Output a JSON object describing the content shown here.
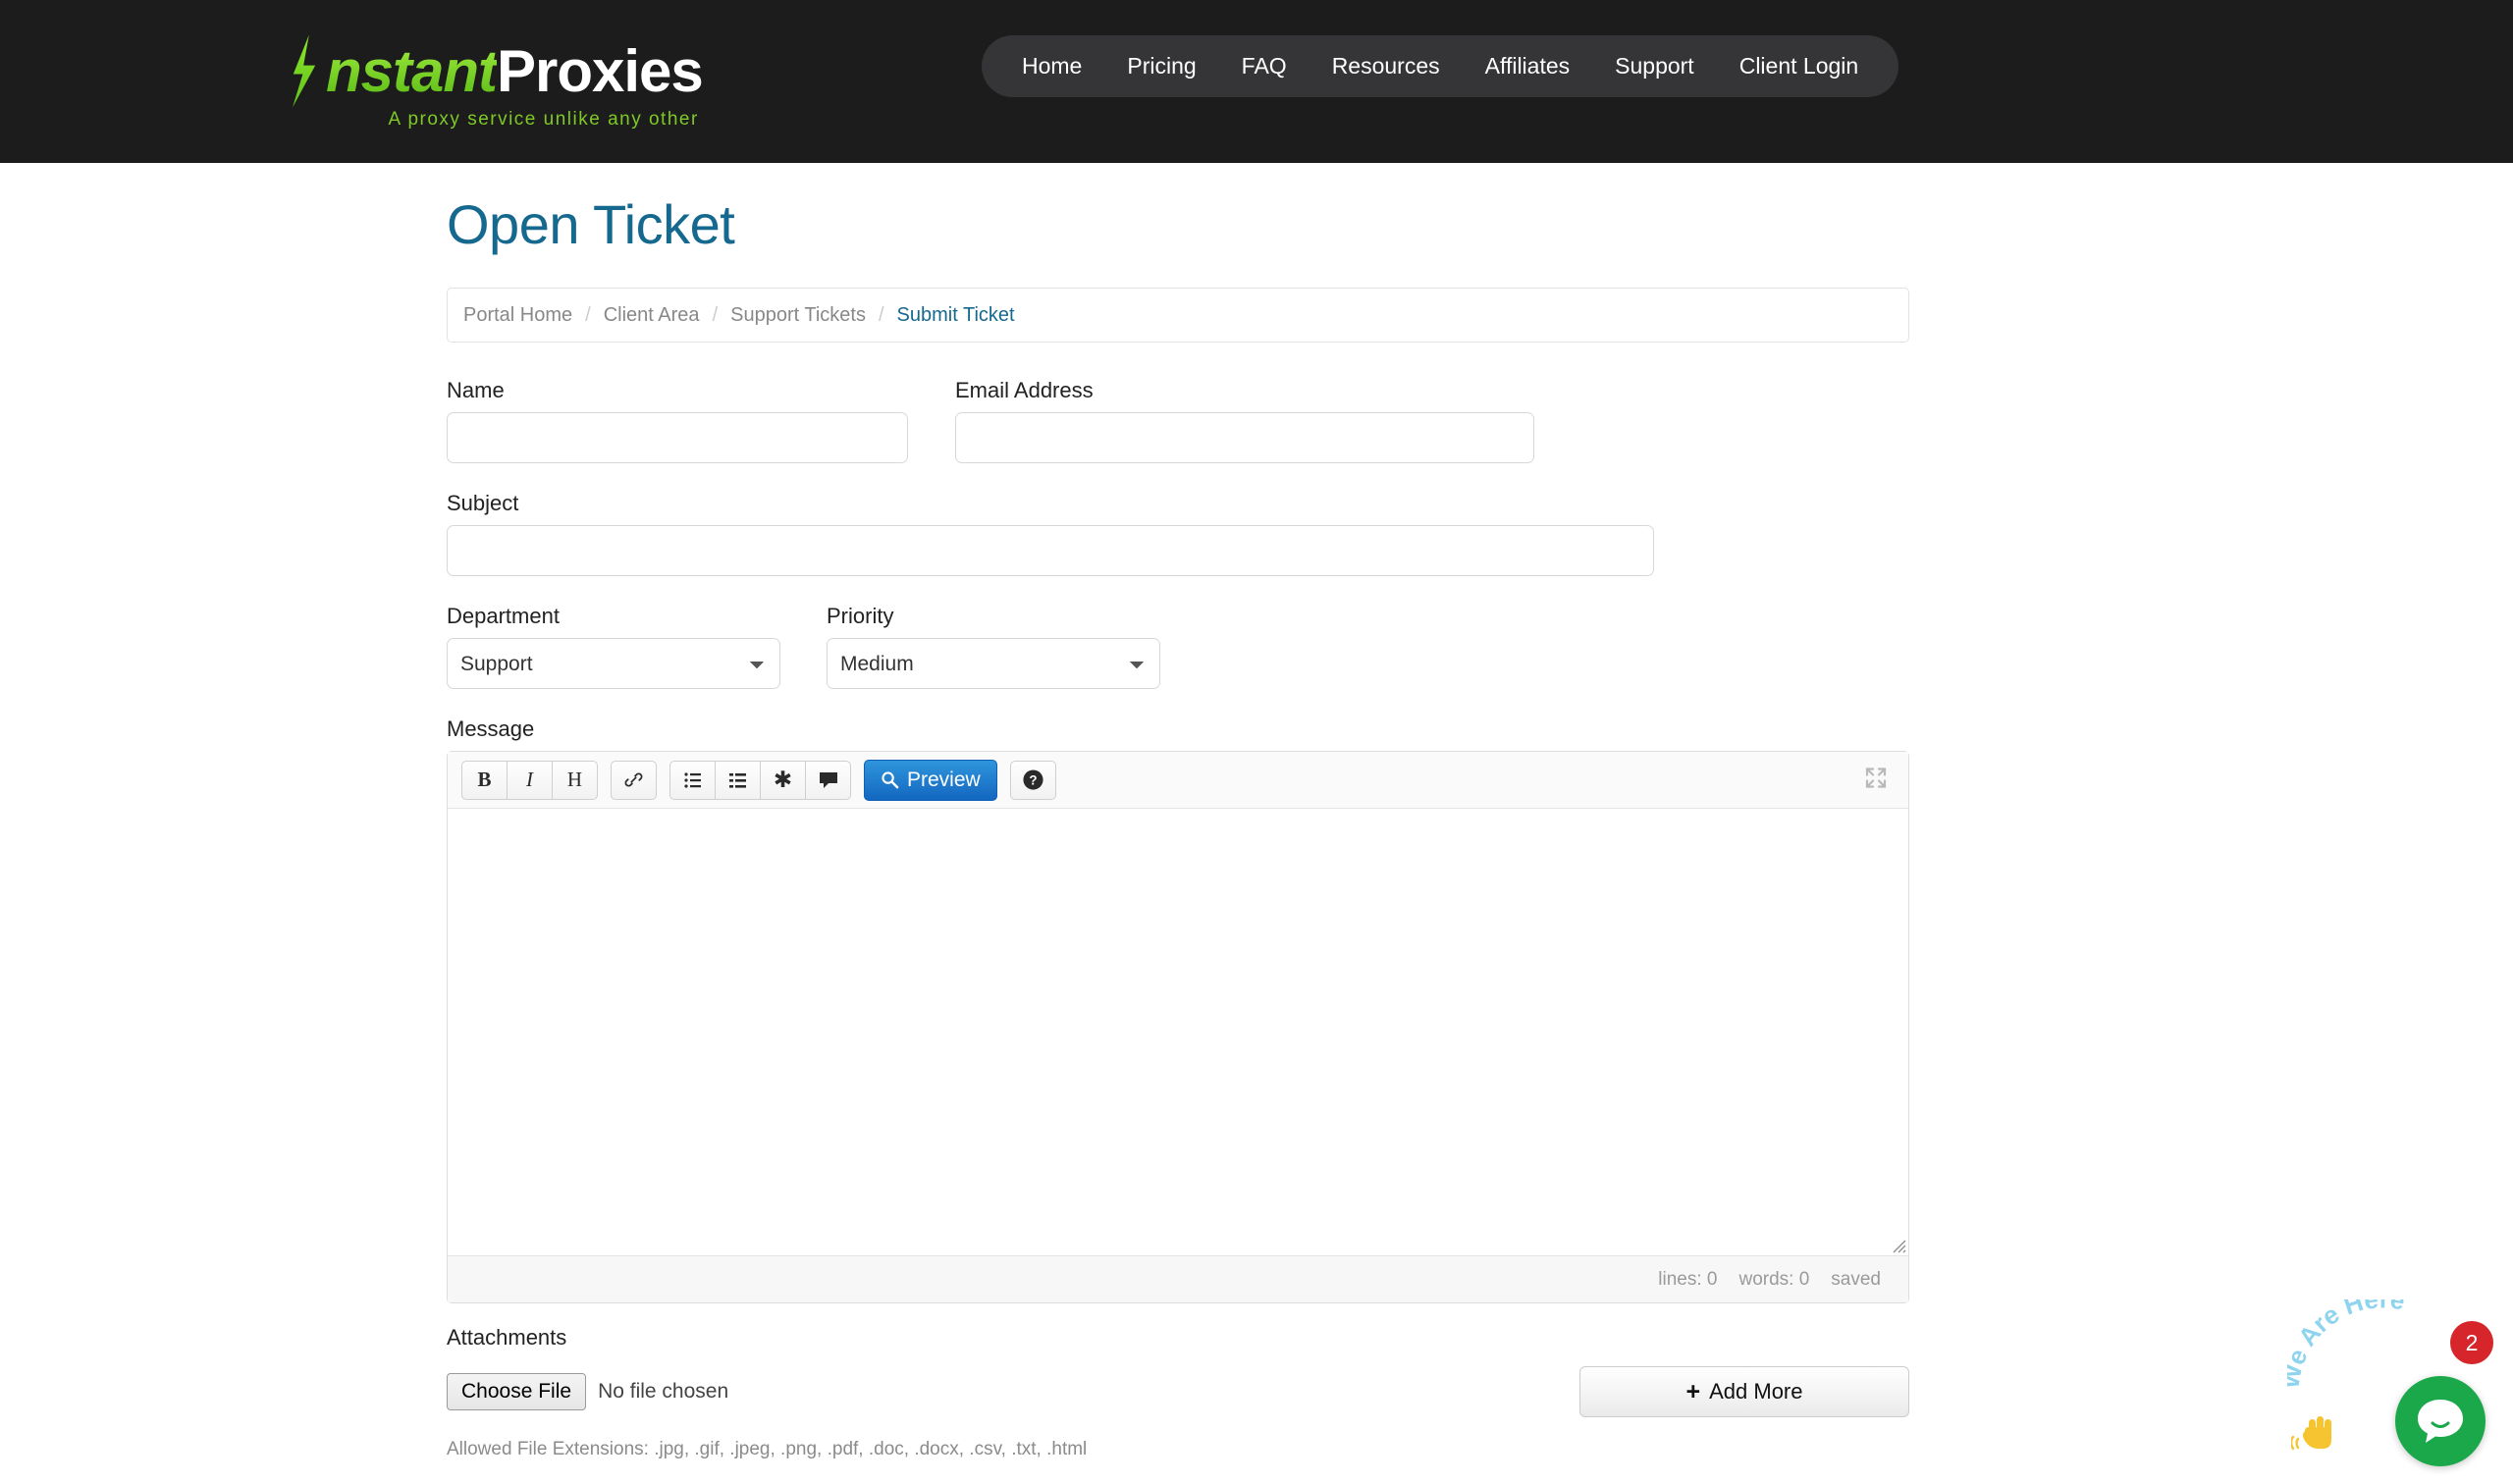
{
  "header": {
    "logo": {
      "bolt_icon": "lightning-bolt-icon",
      "word_instant": "nstant",
      "word_proxies": "Proxies",
      "tagline": "A proxy service unlike any other"
    },
    "nav": [
      {
        "label": "Home"
      },
      {
        "label": "Pricing"
      },
      {
        "label": "FAQ"
      },
      {
        "label": "Resources"
      },
      {
        "label": "Affiliates"
      },
      {
        "label": "Support"
      },
      {
        "label": "Client Login"
      }
    ]
  },
  "page": {
    "title": "Open Ticket",
    "breadcrumb": [
      {
        "label": "Portal Home",
        "active": false
      },
      {
        "label": "Client Area",
        "active": false
      },
      {
        "label": "Support Tickets",
        "active": false
      },
      {
        "label": "Submit Ticket",
        "active": true
      }
    ],
    "separator": "/"
  },
  "form": {
    "name": {
      "label": "Name",
      "value": "",
      "placeholder": ""
    },
    "email": {
      "label": "Email Address",
      "value": "",
      "placeholder": ""
    },
    "subject": {
      "label": "Subject",
      "value": "",
      "placeholder": ""
    },
    "department": {
      "label": "Department",
      "selected": "Support",
      "options": [
        "Support"
      ]
    },
    "priority": {
      "label": "Priority",
      "selected": "Medium",
      "options": [
        "Medium"
      ]
    },
    "message": {
      "label": "Message",
      "value": "",
      "toolbar": {
        "bold": "B",
        "italic": "I",
        "heading": "H",
        "link_icon": "link-icon",
        "unordered_list_icon": "bullet-list-icon",
        "ordered_list_icon": "numbered-list-icon",
        "horizontal_rule_icon": "asterisk-icon",
        "quote_icon": "speech-bubble-icon",
        "preview_label": "Preview",
        "preview_icon": "magnifier-icon",
        "help_icon": "question-circle-icon",
        "expand_icon": "fullscreen-expand-icon",
        "preview_color": "#1c76cc"
      },
      "status": {
        "lines": "lines: 0",
        "words": "words: 0",
        "saved": "saved"
      }
    },
    "attachments": {
      "label": "Attachments",
      "choose_file_label": "Choose File",
      "no_file_text": "No file chosen",
      "add_more_label": "Add More",
      "add_more_icon": "plus-icon",
      "allowed_text": "Allowed File Extensions: .jpg, .gif, .jpeg, .png, .pdf, .doc, .docx, .csv, .txt, .html"
    }
  },
  "chat_widget": {
    "prompt_text": "We Are Here",
    "badge_count": "2",
    "bubble_icon": "chat-bubble-icon",
    "hand_icon": "waving-hand-icon",
    "button_color": "#1aa84a",
    "badge_color": "#d6252b"
  }
}
